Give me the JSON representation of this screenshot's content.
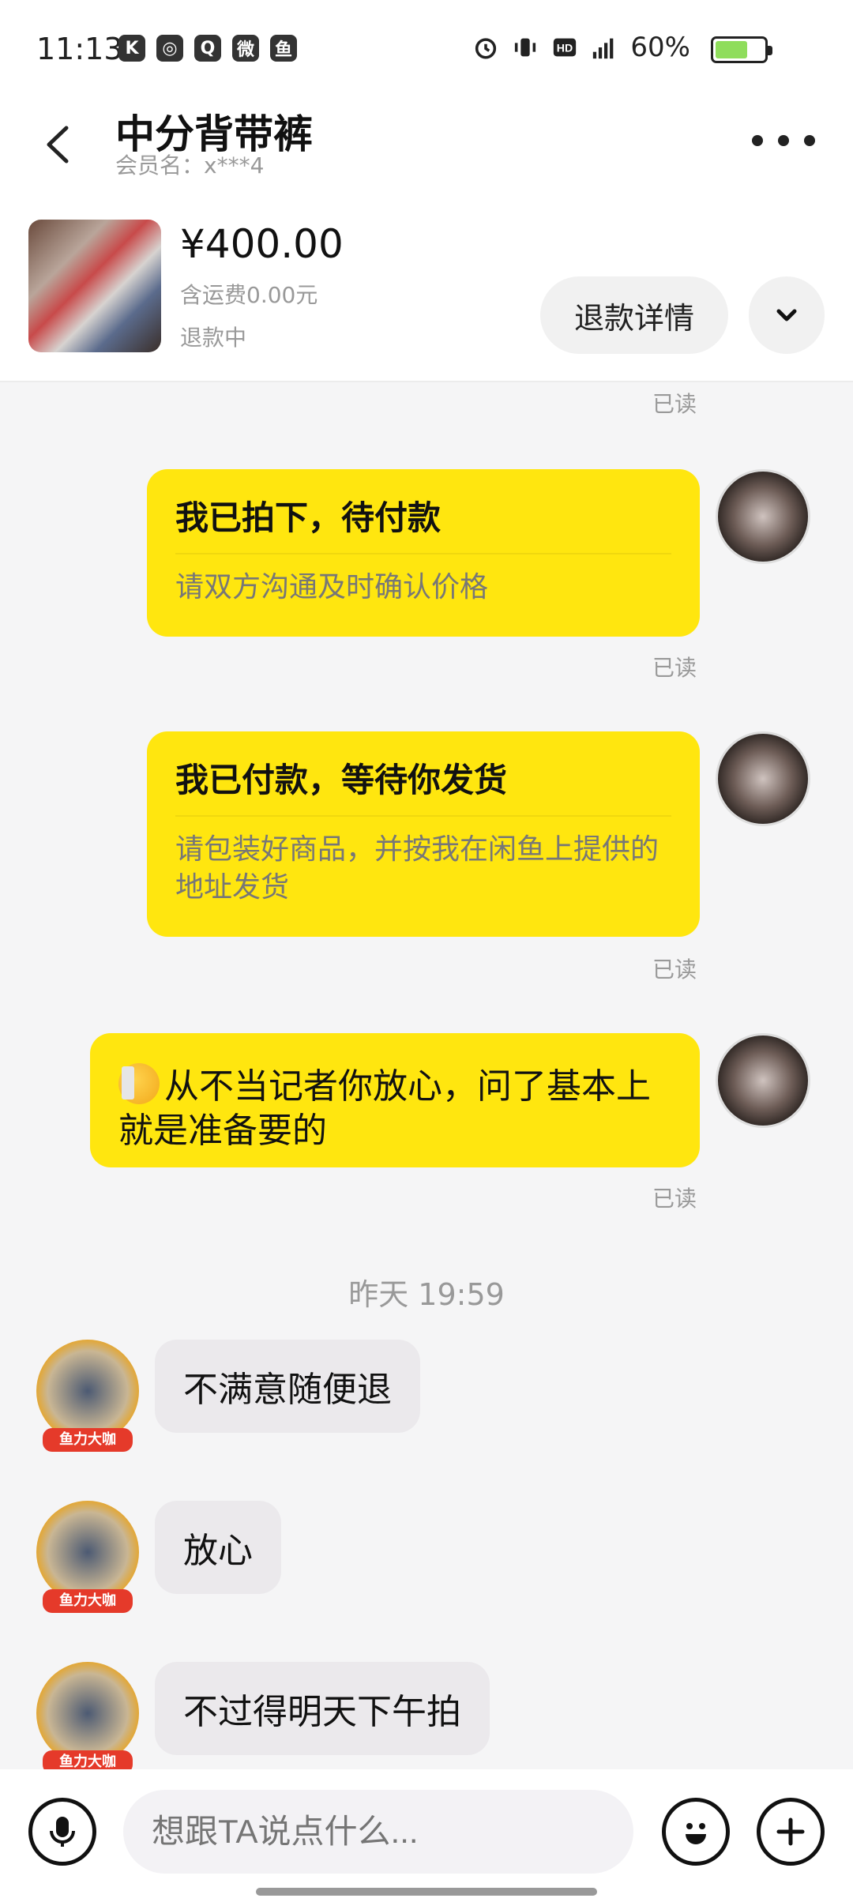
{
  "status_bar": {
    "time": "11:13",
    "battery": "60%",
    "network": "4G"
  },
  "header": {
    "title": "中分背带裤",
    "subtitle": "会员名：x***4"
  },
  "product": {
    "price": "¥400.00",
    "shipping": "含运费0.00元",
    "status": "退款中",
    "refund_button": "退款详情"
  },
  "read_label": "已读",
  "messages": {
    "card1_title": "我已拍下，待付款",
    "card1_sub": "请双方沟通及时确认价格",
    "card2_title": "我已付款，等待你发货",
    "card2_sub": "请包装好商品，并按我在闲鱼上提供的地址发货",
    "text1": "从不当记者你放心，问了基本上就是准备要的",
    "timestamp": "昨天 19:59",
    "other1": "不满意随便退",
    "other2": "放心",
    "other3": "不过得明天下午拍"
  },
  "avatar_badge": "鱼力大咖",
  "input": {
    "placeholder": "想跟TA说点什么..."
  },
  "colors": {
    "my_bubble": "#ffe60f",
    "other_bubble": "#ebe9ec",
    "badge": "#e53a2a"
  }
}
